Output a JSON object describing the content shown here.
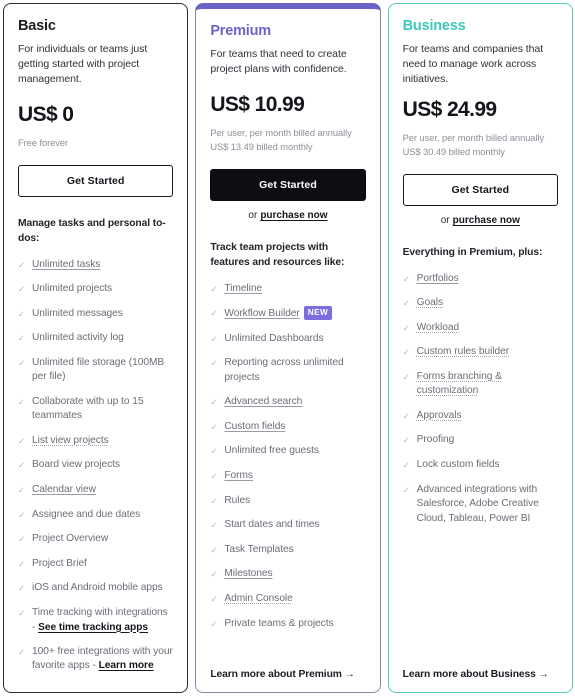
{
  "theme": {
    "premium_accent": "#6c63c7",
    "business_accent": "#3fc9bd",
    "badge_bg": "#7b6fe0",
    "text_dark": "#15151c",
    "text_muted": "#6d6d79",
    "check_icon_glyph": "✓",
    "arrow_icon_glyph": "→"
  },
  "plans": [
    {
      "id": "basic",
      "name": "Basic",
      "description": "For individuals or teams just getting started with project management.",
      "price": "US$ 0",
      "billing_line1": "Free forever",
      "billing_line2": "",
      "cta_label": "Get Started",
      "cta_style": "outline",
      "has_purchase_row": false,
      "purchase_or": "",
      "purchase_label": "",
      "features_heading": "Manage tasks and personal to-dos:",
      "features": [
        {
          "text": "Unlimited tasks",
          "style": "link-solid"
        },
        {
          "text": "Unlimited projects",
          "style": "plain"
        },
        {
          "text": "Unlimited messages",
          "style": "plain"
        },
        {
          "text": "Unlimited activity log",
          "style": "plain"
        },
        {
          "text": "Unlimited file storage (100MB per file)",
          "style": "plain"
        },
        {
          "text": "Collaborate with up to 15 teammates",
          "style": "plain"
        },
        {
          "text": "List view projects",
          "style": "link-dotted"
        },
        {
          "text": "Board view projects",
          "style": "plain"
        },
        {
          "text": "Calendar view",
          "style": "link-solid"
        },
        {
          "text": "Assignee and due dates",
          "style": "plain"
        },
        {
          "text": "Project Overview",
          "style": "plain"
        },
        {
          "text": "Project Brief",
          "style": "plain"
        },
        {
          "text": "iOS and Android mobile apps",
          "style": "plain"
        },
        {
          "text": "Time tracking with integrations - ",
          "style": "plain",
          "inline_link": "See time tracking apps"
        },
        {
          "text": "100+ free integrations with your favorite apps - ",
          "style": "plain",
          "inline_link": "Learn more"
        }
      ],
      "footer_link": "",
      "has_footer_link": false
    },
    {
      "id": "premium",
      "name": "Premium",
      "description": "For teams that need to create project plans with confidence.",
      "price": "US$ 10.99",
      "billing_line1": "Per user, per month billed annually",
      "billing_line2": "US$ 13.49 billed monthly",
      "cta_label": "Get Started",
      "cta_style": "filled",
      "has_purchase_row": true,
      "purchase_or": "or",
      "purchase_label": "purchase now",
      "features_heading": "Track team projects with features and resources like:",
      "features": [
        {
          "text": "Timeline",
          "style": "link-solid"
        },
        {
          "text": "Workflow Builder",
          "style": "link-solid",
          "badge": "NEW"
        },
        {
          "text": "Unlimited Dashboards",
          "style": "plain"
        },
        {
          "text": "Reporting across unlimited projects",
          "style": "plain"
        },
        {
          "text": "Advanced search",
          "style": "link-solid"
        },
        {
          "text": "Custom fields",
          "style": "link-solid"
        },
        {
          "text": "Unlimited free guests",
          "style": "plain"
        },
        {
          "text": "Forms",
          "style": "link-solid"
        },
        {
          "text": "Rules",
          "style": "plain"
        },
        {
          "text": "Start dates and times",
          "style": "plain"
        },
        {
          "text": "Task Templates",
          "style": "plain"
        },
        {
          "text": "Milestones",
          "style": "link-solid"
        },
        {
          "text": "Admin Console",
          "style": "link-dotted"
        },
        {
          "text": "Private teams & projects",
          "style": "plain"
        }
      ],
      "footer_link": "Learn more about Premium",
      "has_footer_link": true
    },
    {
      "id": "business",
      "name": "Business",
      "description": "For teams and companies that need to manage work across initiatives.",
      "price": "US$ 24.99",
      "billing_line1": "Per user, per month billed annually",
      "billing_line2": "US$ 30.49 billed monthly",
      "cta_label": "Get Started",
      "cta_style": "outline",
      "has_purchase_row": true,
      "purchase_or": "or",
      "purchase_label": "purchase now",
      "features_heading": "Everything in Premium, plus:",
      "features": [
        {
          "text": "Portfolios",
          "style": "link-solid"
        },
        {
          "text": "Goals",
          "style": "link-dotted"
        },
        {
          "text": "Workload",
          "style": "link-dotted"
        },
        {
          "text": "Custom rules builder",
          "style": "link-dotted"
        },
        {
          "text": "Forms branching & customization",
          "style": "link-dotted"
        },
        {
          "text": "Approvals",
          "style": "link-dotted"
        },
        {
          "text": "Proofing",
          "style": "plain"
        },
        {
          "text": "Lock custom fields",
          "style": "plain"
        },
        {
          "text": "Advanced integrations with Salesforce, Adobe Creative Cloud, Tableau, Power BI",
          "style": "plain"
        }
      ],
      "footer_link": "Learn more about Business",
      "has_footer_link": true
    }
  ]
}
